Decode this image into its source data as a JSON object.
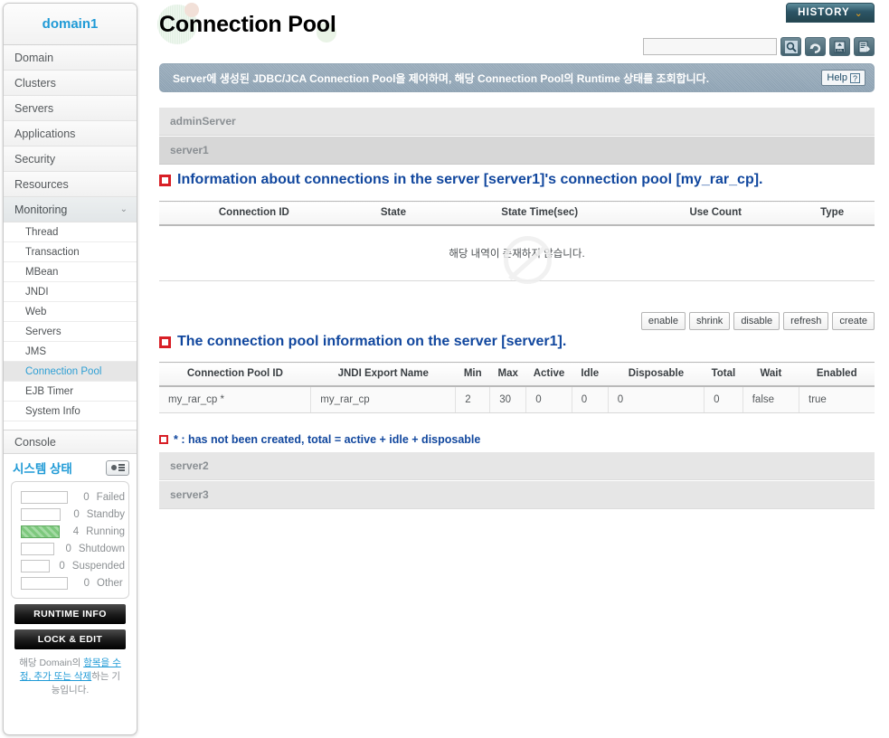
{
  "sidebar": {
    "domain_title": "domain1",
    "nav": [
      {
        "label": "Domain",
        "expandable": false
      },
      {
        "label": "Clusters",
        "expandable": false
      },
      {
        "label": "Servers",
        "expandable": false
      },
      {
        "label": "Applications",
        "expandable": false
      },
      {
        "label": "Security",
        "expandable": false
      },
      {
        "label": "Resources",
        "expandable": false
      },
      {
        "label": "Monitoring",
        "expandable": true,
        "chevron": "⌄"
      }
    ],
    "sub_items": [
      {
        "label": "Thread"
      },
      {
        "label": "Transaction"
      },
      {
        "label": "MBean"
      },
      {
        "label": "JNDI"
      },
      {
        "label": "Web"
      },
      {
        "label": "Servers"
      },
      {
        "label": "JMS"
      },
      {
        "label": "Connection Pool"
      },
      {
        "label": "EJB Timer"
      },
      {
        "label": "System Info"
      }
    ],
    "selected_sub": "Connection Pool",
    "console_label": "Console",
    "system_status_title": "시스템 상태",
    "system_status_icon": "laptop-icon",
    "status_rows": [
      {
        "count": "0",
        "label": "Failed",
        "filled": false
      },
      {
        "count": "0",
        "label": "Standby",
        "filled": false
      },
      {
        "count": "4",
        "label": "Running",
        "filled": true
      },
      {
        "count": "0",
        "label": "Shutdown",
        "filled": false
      },
      {
        "count": "0",
        "label": "Suspended",
        "filled": false
      },
      {
        "count": "0",
        "label": "Other",
        "filled": false
      }
    ],
    "runtime_info_label": "RUNTIME INFO",
    "lock_edit_label": "LOCK & EDIT",
    "note_prefix": "해당 Domain의 ",
    "note_link": "항목을 수정, 추가 또는 삭제",
    "note_suffix": "하는 기능입니다."
  },
  "header": {
    "page_title": "Connection Pool",
    "history_label": "HISTORY",
    "history_arrow": "⌄"
  },
  "toolbar": {
    "search_value": "",
    "search_placeholder": "",
    "icons": [
      {
        "name": "search-icon"
      },
      {
        "name": "refresh-icon"
      },
      {
        "name": "xml-export-icon"
      },
      {
        "name": "save-export-icon"
      }
    ]
  },
  "info_banner": {
    "text": "Server에 생성된 JDBC/JCA Connection Pool을 제어하며, 해당 Connection Pool의 Runtime 상태를 조회합니다.",
    "help_label": "Help",
    "help_icon": "question-mark-icon"
  },
  "server_rows": {
    "admin": "adminServer",
    "server1": "server1",
    "server2": "server2",
    "server3": "server3"
  },
  "section1": {
    "heading": "Information about connections in the server [server1]'s connection pool [my_rar_cp].",
    "columns": [
      "Connection ID",
      "State",
      "State Time(sec)",
      "Use Count",
      "Type"
    ],
    "empty_message": "해당 내역이 존재하지 않습니다.",
    "rows": []
  },
  "action_buttons": [
    "enable",
    "shrink",
    "disable",
    "refresh",
    "create"
  ],
  "section2": {
    "heading": "The connection pool information on the server [server1].",
    "columns": [
      "Connection Pool ID",
      "JNDI Export Name",
      "Min",
      "Max",
      "Active",
      "Idle",
      "Disposable",
      "Total",
      "Wait",
      "Enabled"
    ],
    "rows": [
      {
        "connection_pool_id": "my_rar_cp *",
        "jndi_export_name": "my_rar_cp",
        "min": "2",
        "max": "30",
        "active": "0",
        "idle": "0",
        "disposable": "0",
        "total": "0",
        "wait": "false",
        "enabled": "true"
      }
    ]
  },
  "legend": {
    "text": "* : has not been created, total = active + idle + disposable"
  },
  "colors": {
    "accent_blue": "#1f9ad6",
    "heading_blue": "#11479e",
    "icon_red": "#d81f26",
    "history_teal": "#2c5566",
    "banner_slate": "#93a6b5",
    "running_green": "#7dc87d"
  }
}
